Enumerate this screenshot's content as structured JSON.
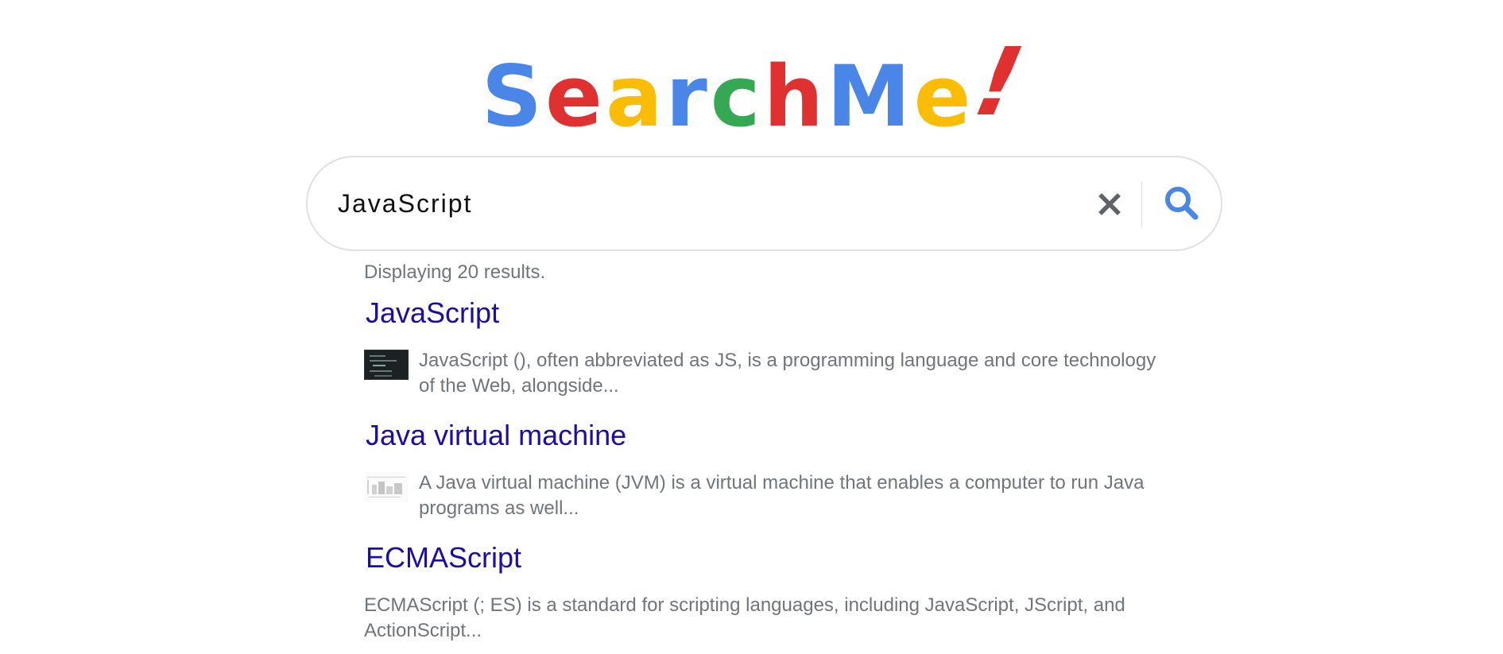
{
  "logo": {
    "letters": [
      {
        "char": "S",
        "color": "#4a86e8"
      },
      {
        "char": "e",
        "color": "#e03131"
      },
      {
        "char": "a",
        "color": "#fbbc05"
      },
      {
        "char": "r",
        "color": "#4a86e8"
      },
      {
        "char": "c",
        "color": "#34a853"
      },
      {
        "char": "h",
        "color": "#e03131"
      },
      {
        "char": "M",
        "color": "#4a86e8"
      },
      {
        "char": "e",
        "color": "#fbbc05"
      },
      {
        "char": "!",
        "color": "#e03131"
      }
    ]
  },
  "search": {
    "value": "JavaScript",
    "clear_icon": "close-icon",
    "search_icon": "search-icon",
    "search_icon_color": "#4a86e8"
  },
  "results": {
    "count_text": "Displaying 20 results.",
    "items": [
      {
        "title": "JavaScript",
        "snippet": "JavaScript (), often abbreviated as JS, is a programming language and core technology of the Web, alongside...",
        "thumbnail": "dark"
      },
      {
        "title": "Java virtual machine",
        "snippet": "A Java virtual machine (JVM) is a virtual machine that enables a computer to run Java programs as well...",
        "thumbnail": "light"
      },
      {
        "title": "ECMAScript",
        "snippet": "ECMAScript (; ES) is a standard for scripting languages, including JavaScript, JScript, and ActionScript...",
        "thumbnail": "none"
      }
    ]
  },
  "colors": {
    "link": "#1a0dab",
    "muted_text": "#70757a",
    "border": "#dfe1e5"
  }
}
